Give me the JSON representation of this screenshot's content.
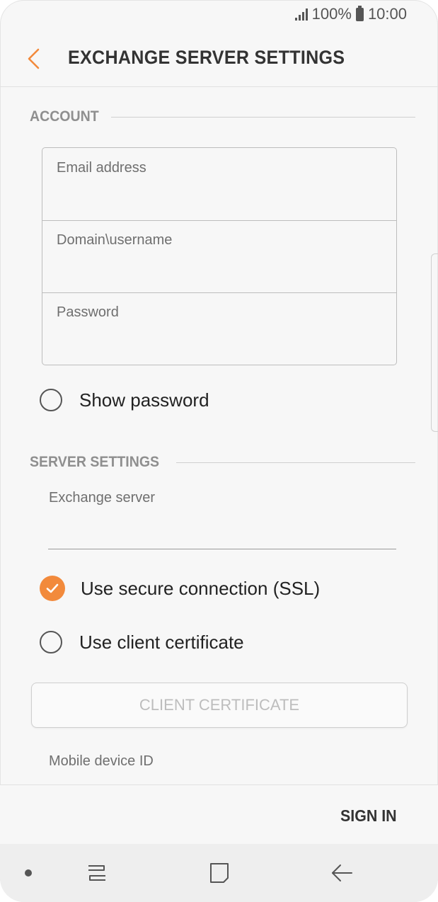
{
  "status_bar": {
    "battery_percent": "100%",
    "time": "10:00"
  },
  "app_bar": {
    "title": "EXCHANGE SERVER SETTINGS",
    "back_icon": "chevron-left-icon"
  },
  "account": {
    "section_label": "ACCOUNT",
    "email_placeholder": "Email address",
    "username_placeholder": "Domain\\username",
    "password_placeholder": "Password",
    "show_password_label": "Show password",
    "show_password_checked": false
  },
  "server": {
    "section_label": "SERVER SETTINGS",
    "exchange_server_label": "Exchange server",
    "exchange_server_value": "",
    "ssl_label": "Use secure connection (SSL)",
    "ssl_checked": true,
    "client_cert_option_label": "Use client certificate",
    "client_cert_option_checked": false,
    "client_cert_button_label": "CLIENT CERTIFICATE",
    "mobile_device_id_label": "Mobile device ID"
  },
  "footer": {
    "sign_in_label": "SIGN IN"
  },
  "colors": {
    "accent": "#f28a3c",
    "background": "#f7f7f7",
    "text": "#333333"
  }
}
